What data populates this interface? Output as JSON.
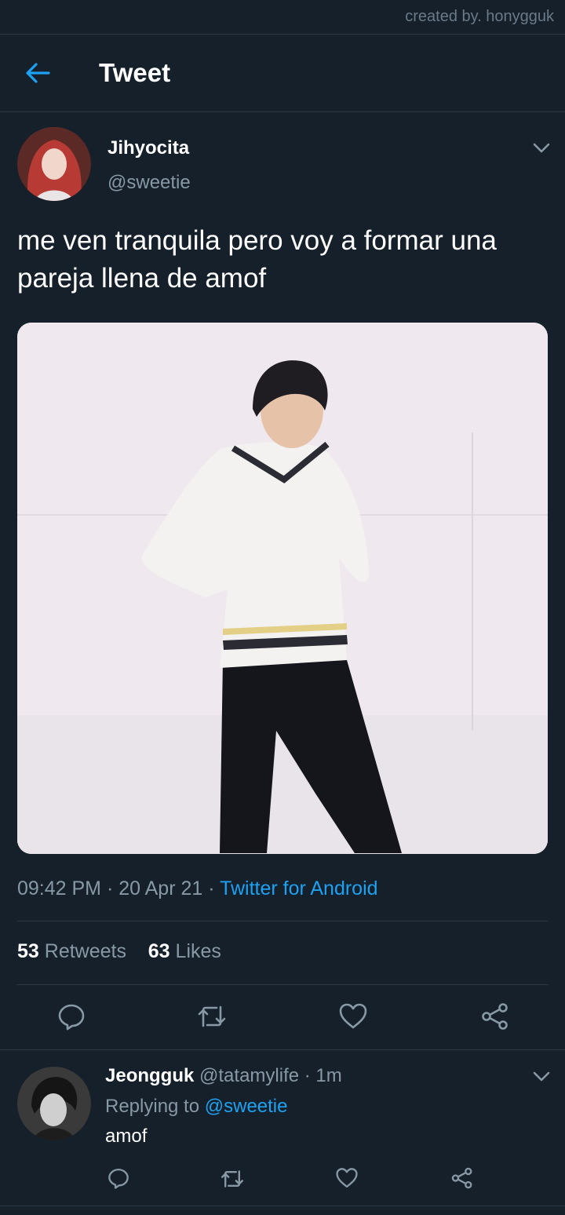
{
  "watermark": "created by. honygguk",
  "header": {
    "title": "Tweet",
    "back_icon": "arrow-left-icon"
  },
  "tweet": {
    "display_name": "Jihyocita",
    "handle": "@sweetie",
    "text": "me ven tranquila pero voy a formar una pareja llena de amof",
    "time": "09:42 PM",
    "date": "20 Apr 21",
    "separator": "·",
    "source": "Twitter for Android",
    "retweets_count": "53",
    "retweets_label": "Retweets",
    "likes_count": "63",
    "likes_label": "Likes"
  },
  "reply": {
    "display_name": "Jeongguk",
    "handle": "@tatamylife",
    "time": "1m",
    "replying_prefix": "Replying to",
    "replying_to": "@sweetie",
    "text": "amof"
  },
  "colors": {
    "background": "#15202b",
    "accent": "#1da1f2",
    "muted": "#8899a6",
    "divider": "#2b3a48"
  }
}
